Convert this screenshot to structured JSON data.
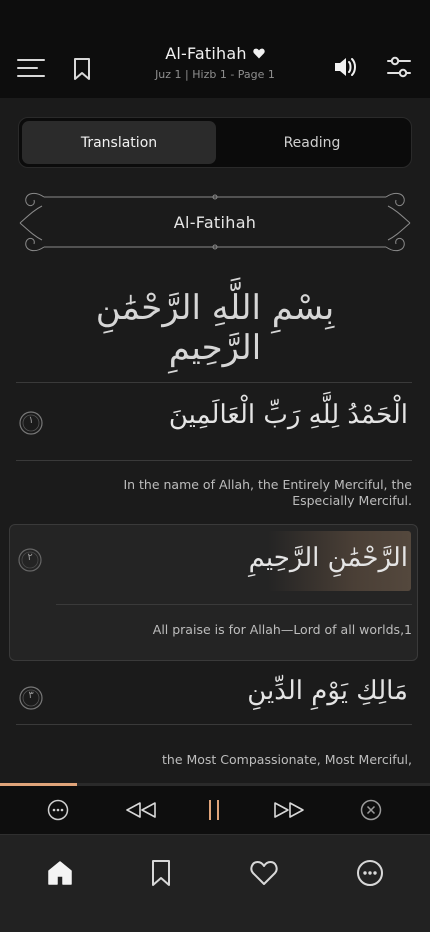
{
  "header": {
    "title": "Al-Fatihah",
    "subtitle": "Juz 1 | Hizb 1 - Page 1"
  },
  "toggle": {
    "translation_label": "Translation",
    "reading_label": "Reading",
    "active": "Translation"
  },
  "surah": {
    "name": "Al-Fatihah",
    "basmala": "بِسْمِ اللَّهِ الرَّحْمَٰنِ الرَّحِيمِ"
  },
  "ayahs": [
    {
      "number": "١",
      "arabic": "الْحَمْدُ لِلَّهِ رَبِّ الْعَالَمِينَ",
      "translation": "In the name of Allah, the Entirely Merciful, the Especially Merciful."
    },
    {
      "number": "٢",
      "arabic": "الرَّحْمَٰنِ الرَّحِيمِ",
      "translation": "All praise is for Allah—Lord of all worlds,1"
    },
    {
      "number": "٣",
      "arabic": "مَالِكِ يَوْمِ الدِّينِ",
      "translation": "the Most Compassionate, Most Merciful,"
    }
  ],
  "player": {
    "progress": 0.18,
    "accent": "#e0a47a",
    "buttons": [
      "more-icon",
      "rewind-icon",
      "pause-icon",
      "fast-forward-icon",
      "close-icon"
    ]
  },
  "tabbar": {
    "items": [
      "home-icon",
      "bookmark-icon",
      "heart-icon",
      "more-icon"
    ],
    "active": "home-icon"
  }
}
